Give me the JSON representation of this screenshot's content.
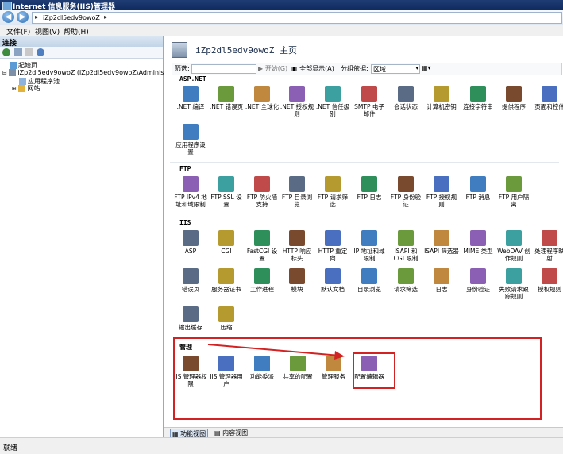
{
  "window": {
    "title": "Internet 信息服务(IIS)管理器"
  },
  "navigation": {
    "address": [
      "iZp2dl5edv9owoZ"
    ],
    "back_icon": "back-arrow-icon",
    "forward_icon": "forward-arrow-icon"
  },
  "menubar": {
    "items": [
      "文件(F)",
      "视图(V)",
      "帮助(H)"
    ]
  },
  "connections": {
    "title": "连接",
    "tree": [
      {
        "label": "起始页",
        "level": 0
      },
      {
        "label": "iZp2dl5edv9owoZ (iZp2dl5edv9owoZ\\Administrator)",
        "level": 0
      },
      {
        "label": "应用程序池",
        "level": 1
      },
      {
        "label": "网站",
        "level": 1
      }
    ]
  },
  "main": {
    "title": "iZp2dl5edv9owoZ 主页",
    "filter": {
      "label": "筛选:",
      "start_label": "开始(G)",
      "show_all_label": "全部显示(A)",
      "group_by_label": "分组依据:",
      "group_by_value": "区域"
    },
    "sections": [
      {
        "name": "ASP.NET",
        "items": [
          ".NET 编译",
          ".NET 错误页",
          ".NET 全球化",
          ".NET 授权规则",
          ".NET 信任级别",
          "SMTP 电子邮件",
          "会话状态",
          "计算机密钥",
          "连接字符串",
          "提供程序",
          "页面和控件",
          "应用程序设置"
        ]
      },
      {
        "name": "FTP",
        "items": [
          "FTP IPv4 地址和域限制",
          "FTP SSL 设置",
          "FTP 防火墙支持",
          "FTP 目录浏览",
          "FTP 请求筛选",
          "FTP 日志",
          "FTP 身份验证",
          "FTP 授权规则",
          "FTP 消息",
          "FTP 用户隔离"
        ]
      },
      {
        "name": "IIS",
        "items": [
          "ASP",
          "CGI",
          "FastCGI 设置",
          "HTTP 响应标头",
          "HTTP 重定向",
          "IP 地址和域限制",
          "ISAPI 和 CGI 限制",
          "ISAPI 筛选器",
          "MIME 类型",
          "WebDAV 创作规则",
          "处理程序映射",
          "错误页",
          "服务器证书",
          "工作进程",
          "模块",
          "默认文档",
          "目录浏览",
          "请求筛选",
          "日志",
          "身份验证",
          "失败请求跟踪规则",
          "授权规则",
          "输出缓存",
          "压缩"
        ]
      },
      {
        "name": "管理",
        "items": [
          "IIS 管理器权限",
          "IIS 管理器用户",
          "功能委派",
          "共享的配置",
          "管理服务",
          "配置编辑器"
        ]
      }
    ],
    "bottom_tabs": [
      "功能视图",
      "内容视图"
    ]
  },
  "statusbar": {
    "text": "就绪"
  },
  "colors": {
    "highlight": "#d32222",
    "title_bar": "#1f3c74"
  }
}
